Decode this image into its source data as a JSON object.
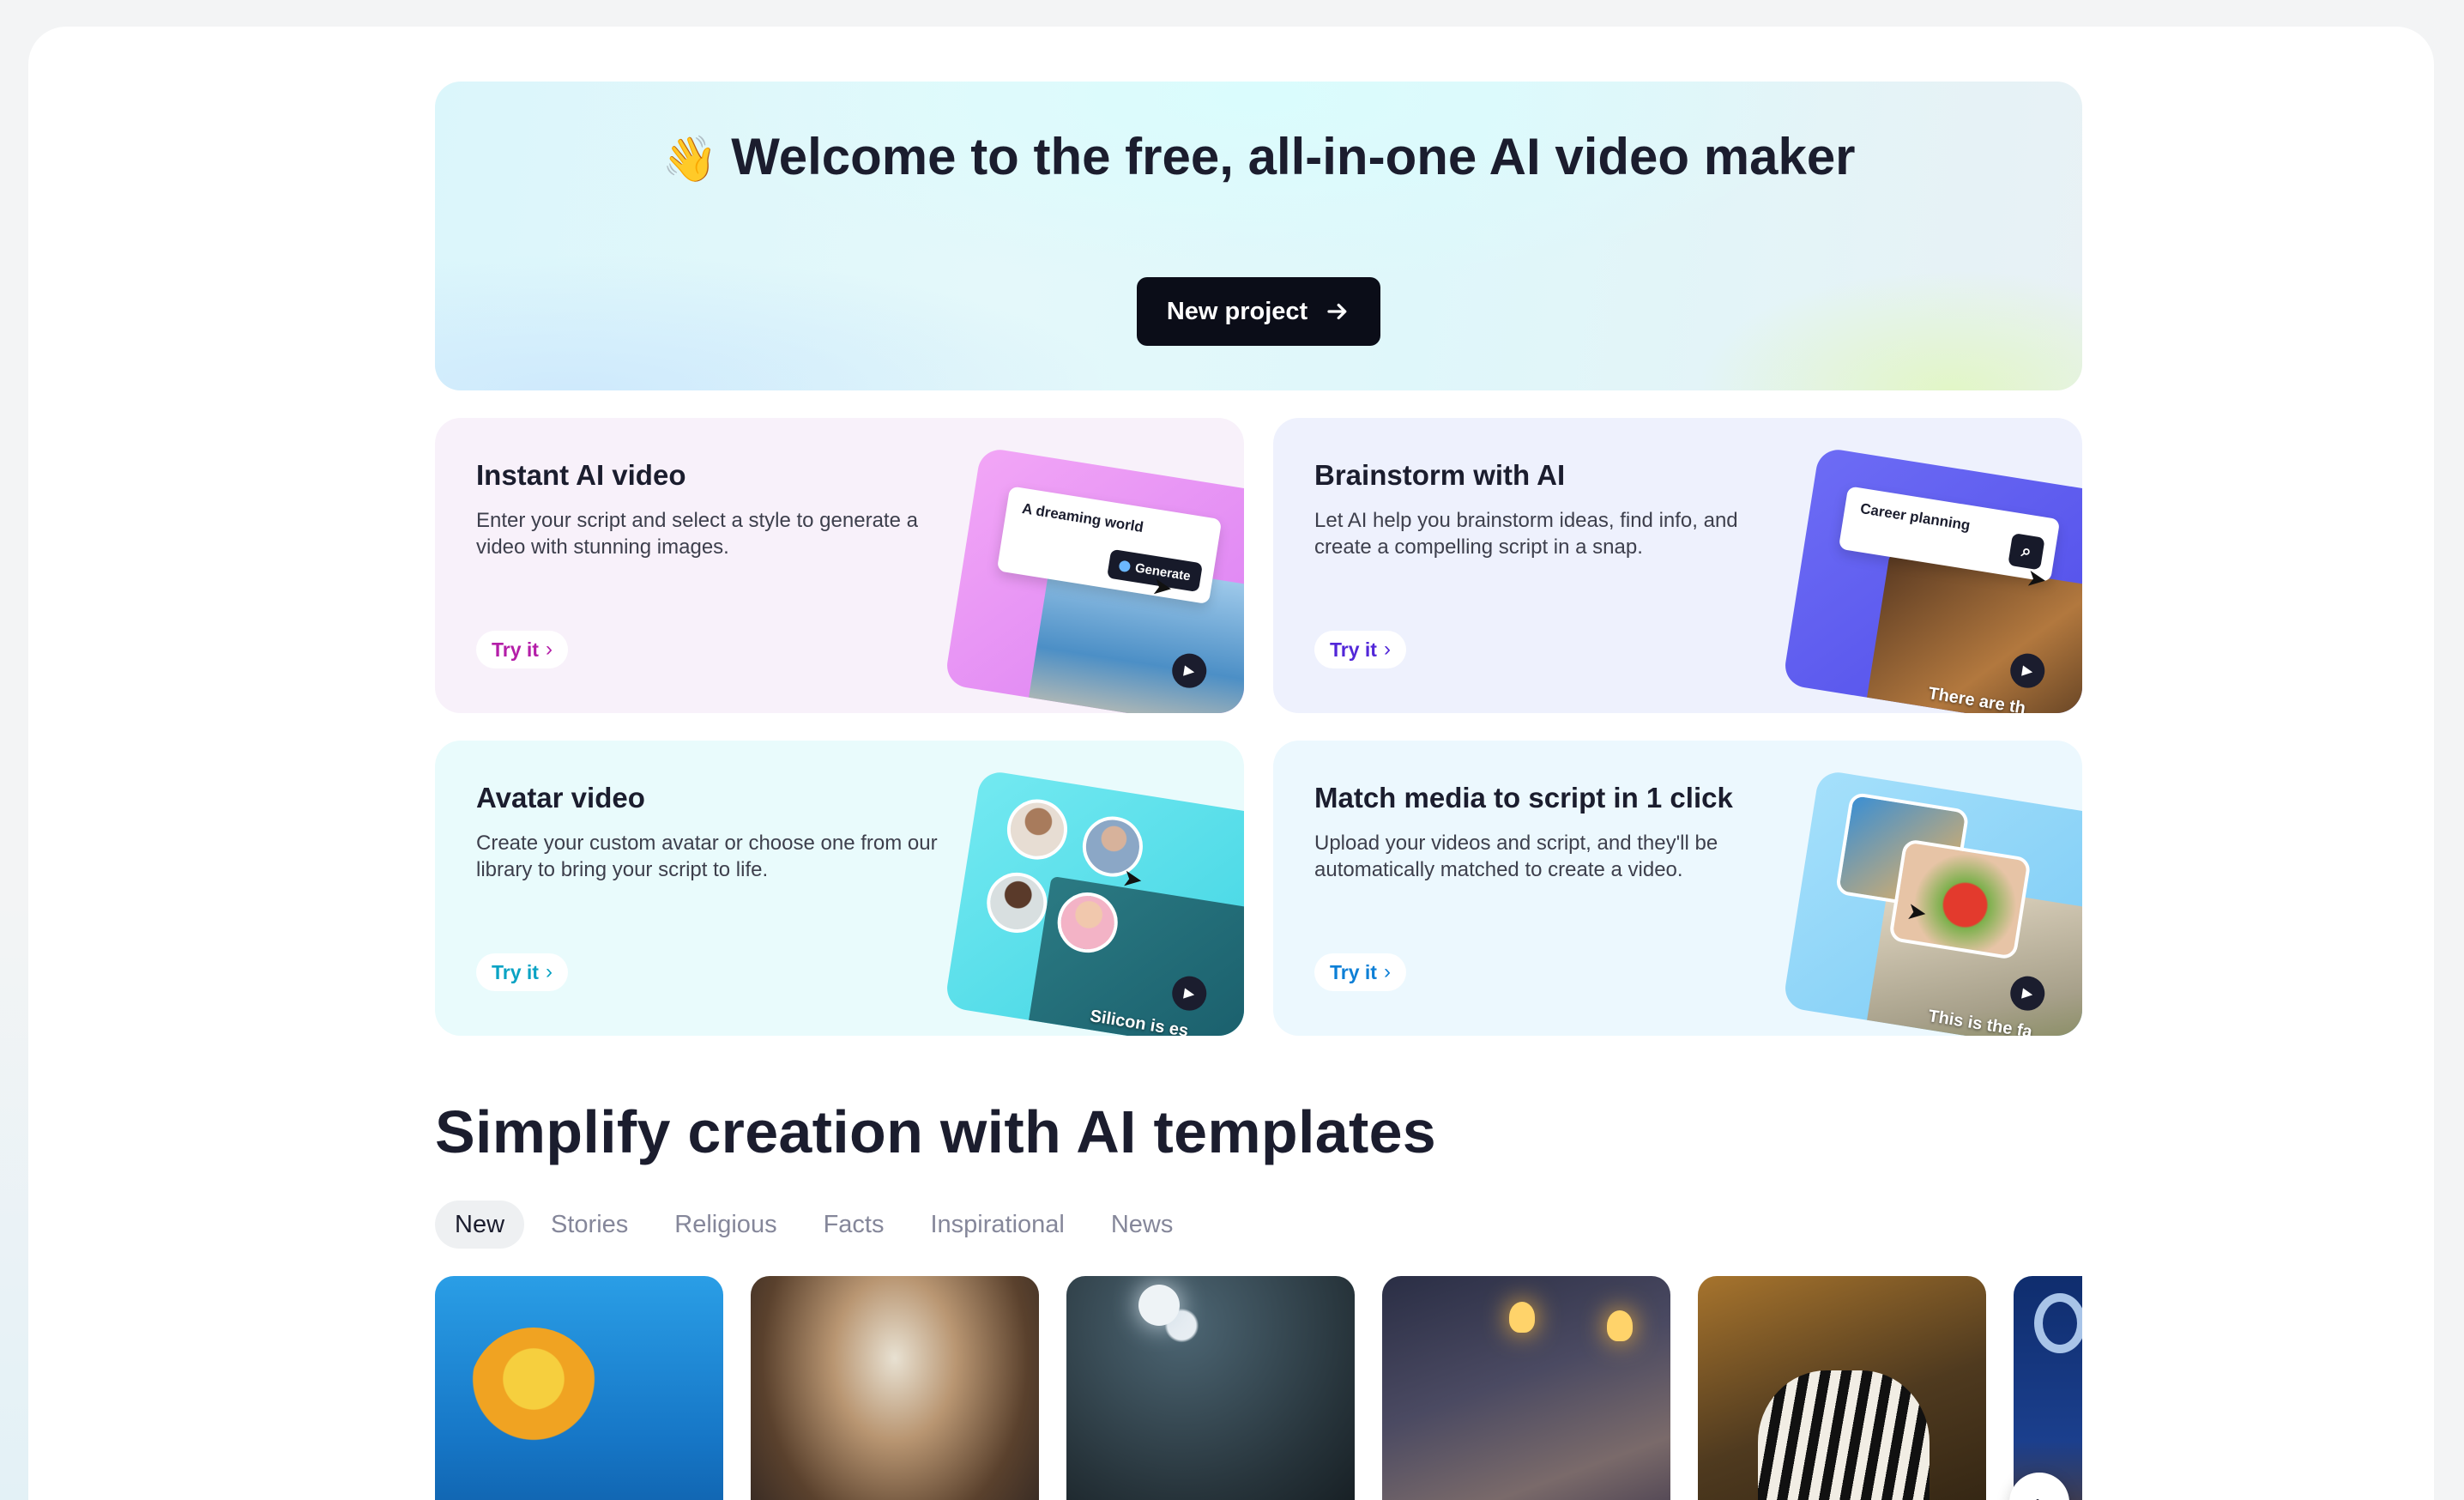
{
  "hero": {
    "wave_emoji": "👋",
    "title": "Welcome to the free, all-in-one AI video maker",
    "new_project_label": "New project"
  },
  "cards": [
    {
      "title": "Instant AI video",
      "description": "Enter your script and select a style to generate a video with stunning images.",
      "try_label": "Try it",
      "preview_prompt": "A dreaming world",
      "preview_button": "Generate",
      "accent": "#b41ea8"
    },
    {
      "title": "Brainstorm with AI",
      "description": "Let AI help you brainstorm ideas, find info, and create a compelling script in a snap.",
      "try_label": "Try it",
      "preview_prompt": "Career planning",
      "preview_caption": "There are th",
      "accent": "#5227d8"
    },
    {
      "title": "Avatar video",
      "description": "Create your custom avatar or choose one from our library to bring your script to life.",
      "try_label": "Try it",
      "preview_caption": "Silicon is es",
      "accent": "#0aa3c4"
    },
    {
      "title": "Match media to script in 1 click",
      "description": "Upload your videos and script, and they'll be automatically matched to create a video.",
      "try_label": "Try it",
      "preview_caption": "This is the fa",
      "accent": "#0d7fd6"
    }
  ],
  "templates": {
    "title": "Simplify creation with AI templates",
    "tabs": [
      "New",
      "Stories",
      "Religious",
      "Facts",
      "Inspirational",
      "News"
    ],
    "active_tab": "New"
  },
  "icons": {
    "arrow": "arrow-right-icon",
    "chevron": "chevron-right-icon",
    "play": "play-icon",
    "search": "search-icon",
    "cursor": "pointer-cursor-icon"
  }
}
